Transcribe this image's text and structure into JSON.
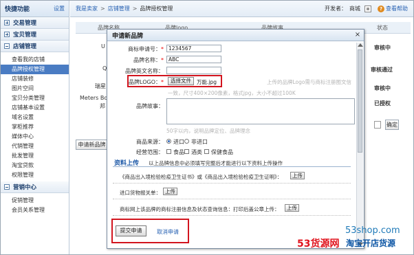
{
  "sidebar": {
    "title": "快捷功能",
    "settings_label": "设置",
    "sections": [
      {
        "label": "交易管理",
        "expanded": false
      },
      {
        "label": "宝贝管理",
        "expanded": false
      },
      {
        "label": "店铺管理",
        "expanded": true
      }
    ],
    "store_items": [
      "查看我的店铺",
      "品牌授权管理",
      "店铺装修",
      "图片空间",
      "宝贝分类管理",
      "店铺基本设置",
      "域名设置",
      "掌柜推荐",
      "媒体中心",
      "代销管理",
      "批发管理",
      "淘宝贷款",
      "权限管理"
    ],
    "active_item": "品牌授权管理",
    "marketing_section": "营销中心",
    "marketing_items": [
      "促销管理",
      "会员关系管理"
    ]
  },
  "topbar": {
    "breadcrumb": [
      "我是卖家",
      "店铺管理",
      "品牌授权管理"
    ],
    "separator": ">",
    "developer_label": "开发者：",
    "developer_name": "商城",
    "help_label": "查看帮助",
    "help_icon": "question-icon",
    "home_icon": "home-icon"
  },
  "background_table": {
    "headers": [
      "品牌名称",
      "品牌logo",
      "品牌故事",
      "状态"
    ],
    "row_fragments": [
      "U",
      "Q",
      "瑞星",
      "Meters Bon",
      "邦"
    ],
    "statuses": [
      "审核中",
      "审核通过",
      "审核中",
      "已授权"
    ],
    "apply_button": "申请新品牌",
    "confirm_button": "确定"
  },
  "modal": {
    "title": "申请新品牌",
    "close_icon": "close-icon",
    "fields": {
      "apply_no_label": "商标申请号：",
      "apply_no_value": "1234567",
      "brand_name_label": "品牌名称：",
      "brand_name_value": "ABC",
      "brand_en_label": "品牌英文名称：",
      "brand_en_value": "",
      "logo_label": "品牌LOGO：",
      "logo_button": "选择文件",
      "logo_filename": "万能.jpg",
      "logo_hint_right": "上传的品牌Logo需与商标注册图文信",
      "logo_hint_below": "一致，尺寸400×200像素，格式jpg，大小不超过100K",
      "story_label": "品牌故事：",
      "story_hint": "50字以内，说明品牌定位、品牌理念",
      "source_label": "商品来源：",
      "source_options": [
        "进口",
        "非进口"
      ],
      "source_selected": "进口",
      "scope_label": "经营范围：",
      "scope_options": [
        "食品",
        "酒类",
        "保健食品"
      ]
    },
    "upload_section": {
      "title": "资料上传",
      "note": "以上品牌信息中必须填写完整后才能进行以下资料上传操作",
      "docs": [
        "《商品出入境检验检疫卫生证书》或《商品出入境检验检疫卫生证明》：",
        "进口货物报关单：",
        "商标网上该品牌的商标注册信息及状态查询信息：打印后盖公章上传："
      ],
      "upload_button": "上传"
    },
    "submit_button": "提交申请",
    "cancel_link": "取消申请"
  },
  "watermark": {
    "site": "53shop.com",
    "brand_red": "53货源网",
    "brand_blue": "淘宝开店货源"
  }
}
